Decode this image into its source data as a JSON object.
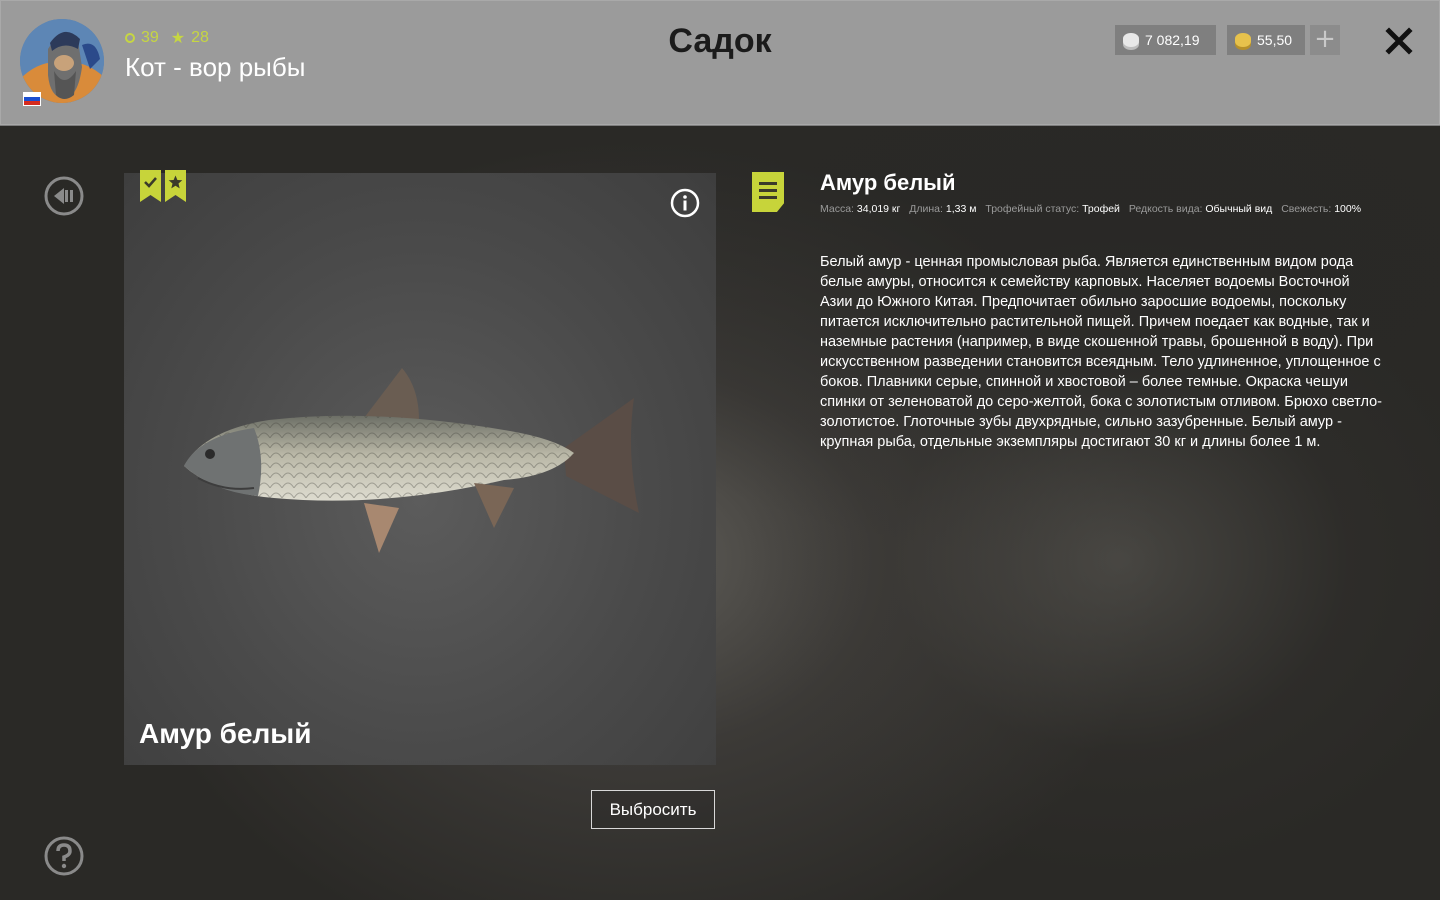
{
  "header": {
    "title": "Садок",
    "player": {
      "level": "39",
      "rank": "28",
      "name": "Кот - вор рыбы"
    },
    "currency": {
      "silver": "7 082,19",
      "gold": "55,50"
    }
  },
  "fish": {
    "name": "Амур белый",
    "stats": [
      {
        "label": "Масса:",
        "value": "34,019 кг"
      },
      {
        "label": "Длина:",
        "value": "1,33 м"
      },
      {
        "label": "Трофейный статус:",
        "value": "Трофей"
      },
      {
        "label": "Редкость вида:",
        "value": "Обычный вид"
      },
      {
        "label": "Свежесть:",
        "value": "100%"
      }
    ],
    "description": "Белый амур - ценная промысловая рыба. Является единственным видом рода белые амуры, относится к семейству карповых. Населяет водоемы Восточной Азии до Южного Китая. Предпочитает обильно заросшие водоемы, поскольку питается исключительно растительной пищей. Причем поедает как водные, так и наземные растения (например, в виде скошенной травы, брошенной в воду). При искусственном разведении становится всеядным. Тело удлиненное, уплощенное с боков. Плавники серые, спинной и хвостовой – более темные. Окраска чешуи спинки от зеленоватой до серо-желтой, бока с золотистым отливом. Брюхо светло-золотистое. Глоточные зубы двухрядные, сильно зазубренные. Белый амур - крупная рыба, отдельные экземпляры достигают 30 кг и длины более 1 м."
  },
  "actions": {
    "discard": "Выбросить"
  },
  "colors": {
    "accent": "#c7d43a",
    "header_bg": "#9b9b9b"
  },
  "icons": [
    "back-icon",
    "help-icon",
    "close-icon",
    "info-icon",
    "note-icon",
    "check-badge-icon",
    "star-badge-icon",
    "silver-coin-icon",
    "gold-coin-icon",
    "plus-icon"
  ]
}
